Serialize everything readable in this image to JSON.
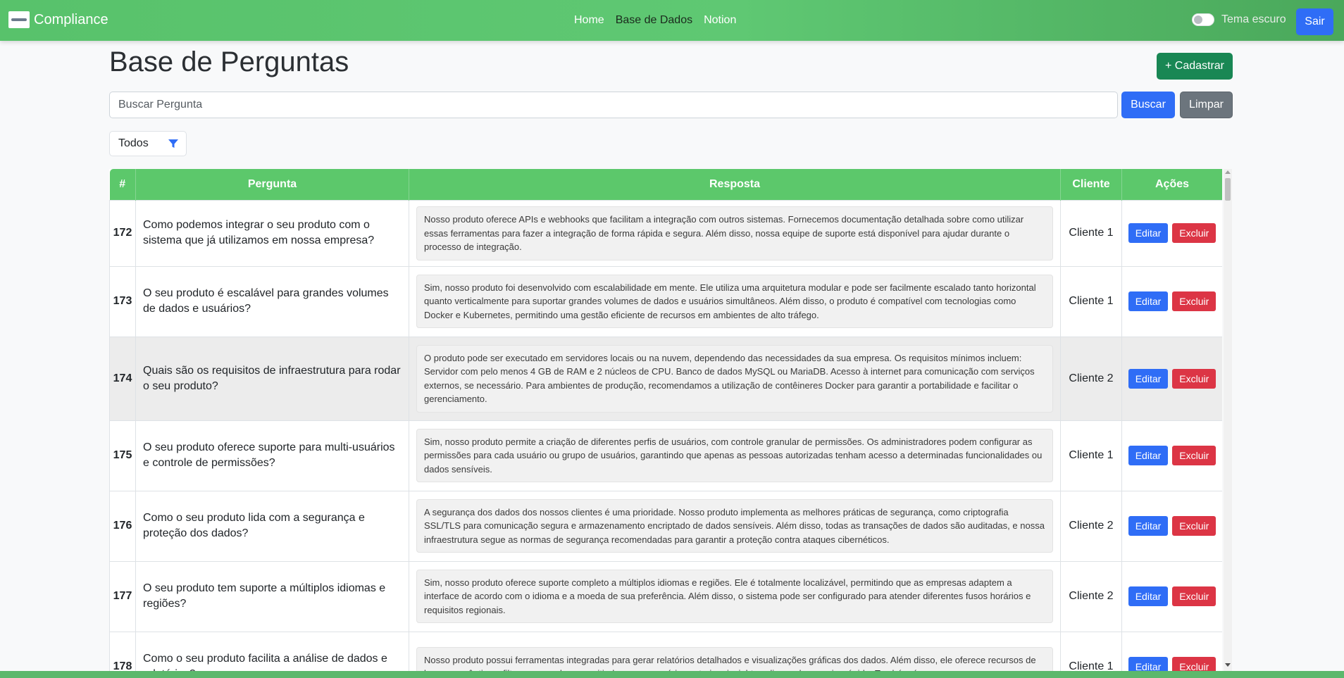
{
  "navbar": {
    "brand": "Compliance",
    "links": [
      "Home",
      "Base de Dados",
      "Notion"
    ],
    "theme_label": "Tema escuro",
    "logout_label": "Sair"
  },
  "header": {
    "title": "Base de Perguntas",
    "add_label": "+ Cadastrar"
  },
  "search": {
    "placeholder": "Buscar Pergunta",
    "value": "",
    "search_label": "Buscar",
    "clear_label": "Limpar"
  },
  "filter": {
    "selected": "Todos"
  },
  "table": {
    "columns": [
      "#",
      "Pergunta",
      "Resposta",
      "Cliente",
      "Ações"
    ],
    "edit_label": "Editar",
    "delete_label": "Excluir",
    "rows": [
      {
        "id": "172",
        "pergunta": "Como podemos integrar o seu produto com o sistema que já utilizamos em nossa empresa?",
        "resposta": "Nosso produto oferece APIs e webhooks que facilitam a integração com outros sistemas. Fornecemos documentação detalhada sobre como utilizar essas ferramentas para fazer a integração de forma rápida e segura. Além disso, nossa equipe de suporte está disponível para ajudar durante o processo de integração.",
        "cliente": "Cliente 1"
      },
      {
        "id": "173",
        "pergunta": "O seu produto é escalável para grandes volumes de dados e usuários?",
        "resposta": "Sim, nosso produto foi desenvolvido com escalabilidade em mente. Ele utiliza uma arquitetura modular e pode ser facilmente escalado tanto horizontal quanto verticalmente para suportar grandes volumes de dados e usuários simultâneos. Além disso, o produto é compatível com tecnologias como Docker e Kubernetes, permitindo uma gestão eficiente de recursos em ambientes de alto tráfego.",
        "cliente": "Cliente 1"
      },
      {
        "id": "174",
        "pergunta": "Quais são os requisitos de infraestrutura para rodar o seu produto?",
        "resposta": "O produto pode ser executado em servidores locais ou na nuvem, dependendo das necessidades da sua empresa. Os requisitos mínimos incluem: Servidor com pelo menos 4 GB de RAM e 2 núcleos de CPU. Banco de dados MySQL ou MariaDB. Acesso à internet para comunicação com serviços externos, se necessário. Para ambientes de produção, recomendamos a utilização de contêineres Docker para garantir a portabilidade e facilitar o gerenciamento.",
        "cliente": "Cliente 2"
      },
      {
        "id": "175",
        "pergunta": "O seu produto oferece suporte para multi-usuários e controle de permissões?",
        "resposta": "Sim, nosso produto permite a criação de diferentes perfis de usuários, com controle granular de permissões. Os administradores podem configurar as permissões para cada usuário ou grupo de usuários, garantindo que apenas as pessoas autorizadas tenham acesso a determinadas funcionalidades ou dados sensíveis.",
        "cliente": "Cliente 1"
      },
      {
        "id": "176",
        "pergunta": "Como o seu produto lida com a segurança e proteção dos dados?",
        "resposta": "A segurança dos dados dos nossos clientes é uma prioridade. Nosso produto implementa as melhores práticas de segurança, como criptografia SSL/TLS para comunicação segura e armazenamento encriptado de dados sensíveis. Além disso, todas as transações de dados são auditadas, e nossa infraestrutura segue as normas de segurança recomendadas para garantir a proteção contra ataques cibernéticos.",
        "cliente": "Cliente 2"
      },
      {
        "id": "177",
        "pergunta": "O seu produto tem suporte a múltiplos idiomas e regiões?",
        "resposta": "Sim, nosso produto oferece suporte completo a múltiplos idiomas e regiões. Ele é totalmente localizável, permitindo que as empresas adaptem a interface de acordo com o idioma e a moeda de sua preferência. Além disso, o sistema pode ser configurado para atender diferentes fusos horários e requisitos regionais.",
        "cliente": "Cliente 2"
      },
      {
        "id": "178",
        "pergunta": "Como o seu produto facilita a análise de dados e relatórios?",
        "resposta": "Nosso produto possui ferramentas integradas para gerar relatórios detalhados e visualizações gráficas dos dados. Além disso, ele oferece recursos de busca semântica e filtros avançados, permitindo que os usuários extraiam insights valiosos de maneira rápida. Também é",
        "cliente": "Cliente 1"
      }
    ]
  }
}
